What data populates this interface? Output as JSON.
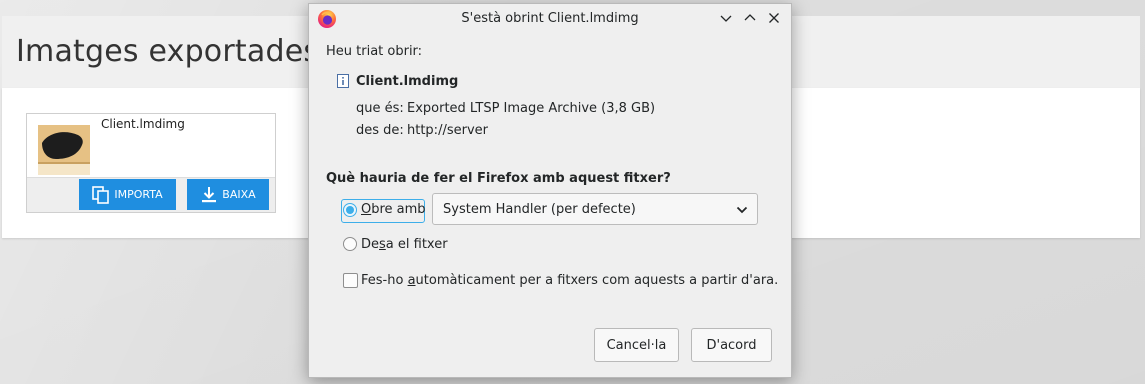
{
  "background": {
    "page_title": "Imatges exportades",
    "card": {
      "file_name": "Client.lmdimg",
      "import_label": "IMPORTA",
      "download_label": "BAIXA"
    }
  },
  "dialog": {
    "title": "S'està obrint Client.lmdimg",
    "chosen_label": "Heu triat obrir:",
    "file_name": "Client.lmdimg",
    "type_label": "que és:",
    "type_value": "Exported LTSP Image Archive (3,8 GB)",
    "from_label": "des de:",
    "from_value": "http://server",
    "question": "Què hauria de fer el Firefox amb aquest fitxer?",
    "open_with": {
      "pre": "",
      "key": "O",
      "post": "bre amb"
    },
    "handler_selected": "System Handler (per defecte)",
    "save_file": {
      "pre": "De",
      "key": "s",
      "post": "a el fitxer"
    },
    "auto": {
      "pre": "Fes-ho ",
      "key": "a",
      "post": "utomàticament per a fitxers com aquests a partir d'ara."
    },
    "cancel_label": "Cancel·la",
    "ok_label": "D'acord"
  },
  "colors": {
    "accent": "#3daee9",
    "button_blue": "#1f8ee0",
    "firefox_orange": "#ff7139"
  }
}
